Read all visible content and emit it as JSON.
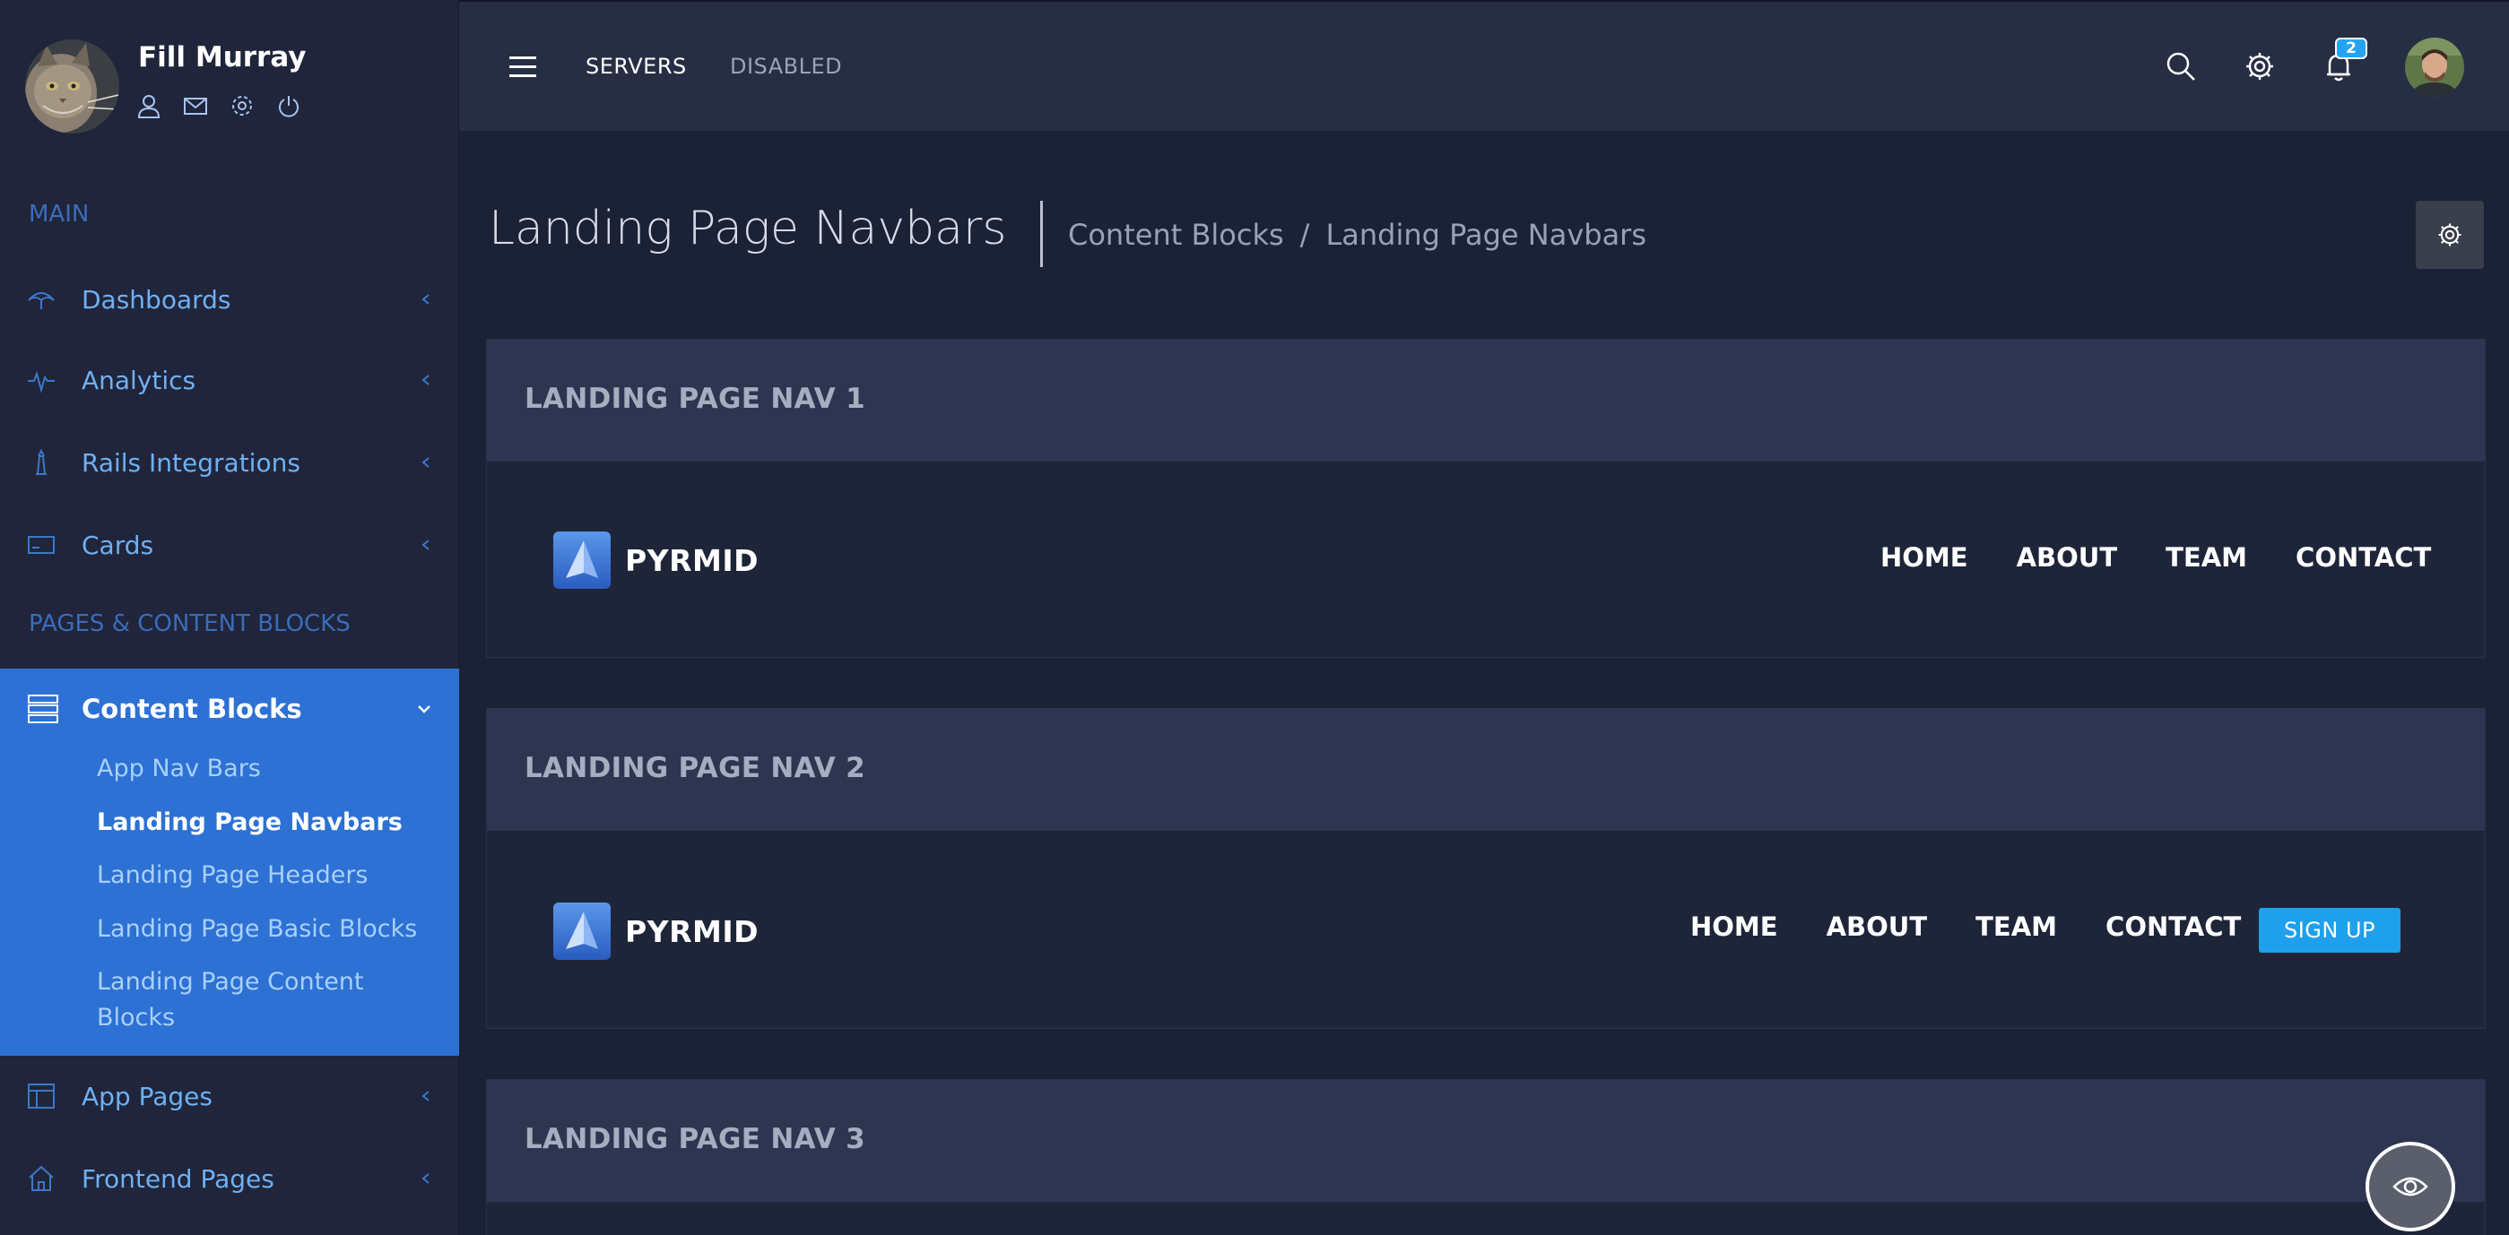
{
  "profile": {
    "name": "Fill Murray"
  },
  "sidebar": {
    "section_main": "MAIN",
    "section_pages": "PAGES & CONTENT BLOCKS",
    "items": [
      {
        "label": "Dashboards",
        "icon": "umbrella-icon"
      },
      {
        "label": "Analytics",
        "icon": "pulse-icon"
      },
      {
        "label": "Rails Integrations",
        "icon": "lighthouse-icon"
      },
      {
        "label": "Cards",
        "icon": "card-icon"
      },
      {
        "label": "App Pages",
        "icon": "layout-icon"
      },
      {
        "label": "Frontend Pages",
        "icon": "home-icon"
      }
    ],
    "active": {
      "label": "Content Blocks",
      "icon": "list-icon",
      "children": [
        "App Nav Bars",
        "Landing Page Navbars",
        "Landing Page Headers",
        "Landing Page Basic Blocks",
        "Landing Page Content Blocks"
      ]
    }
  },
  "topbar": {
    "link_servers": "SERVERS",
    "link_disabled": "DISABLED",
    "notification_count": "2"
  },
  "page": {
    "title": "Landing Page Navbars",
    "breadcrumb": [
      "Content Blocks",
      "/",
      "Landing Page Navbars"
    ]
  },
  "cards": [
    {
      "title": "LANDING PAGE NAV 1",
      "brand": "PYRMID",
      "links": [
        "HOME",
        "ABOUT",
        "TEAM",
        "CONTACT"
      ]
    },
    {
      "title": "LANDING PAGE NAV 2",
      "brand": "PYRMID",
      "links": [
        "HOME",
        "ABOUT",
        "TEAM",
        "CONTACT"
      ],
      "button": "SIGN UP"
    },
    {
      "title": "LANDING PAGE NAV 3"
    }
  ],
  "colors": {
    "sidebar_bg": "#20253b",
    "active_bg": "#2d71d4",
    "accent": "#1ea0ec",
    "content_bg": "#1b2236"
  }
}
